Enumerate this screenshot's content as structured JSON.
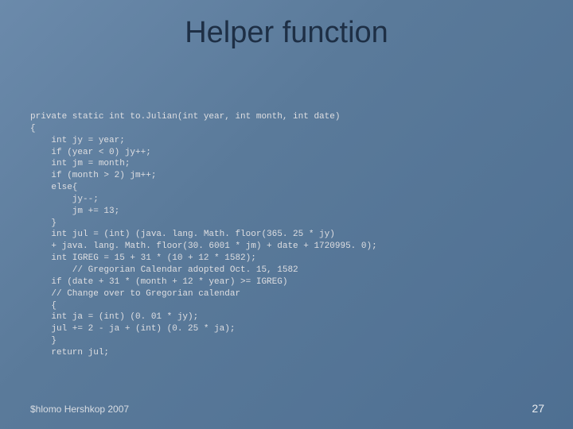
{
  "title": "Helper function",
  "code": "private static int to.Julian(int year, int month, int date)\n{\n    int jy = year;\n    if (year < 0) jy++;\n    int jm = month;\n    if (month > 2) jm++;\n    else{\n        jy--;\n        jm += 13;\n    }\n    int jul = (int) (java. lang. Math. floor(365. 25 * jy)\n    + java. lang. Math. floor(30. 6001 * jm) + date + 1720995. 0);\n    int IGREG = 15 + 31 * (10 + 12 * 1582);\n        // Gregorian Calendar adopted Oct. 15, 1582\n    if (date + 31 * (month + 12 * year) >= IGREG)\n    // Change over to Gregorian calendar\n    {\n    int ja = (int) (0. 01 * jy);\n    jul += 2 - ja + (int) (0. 25 * ja);\n    }\n    return jul;",
  "footer_left": "$hlomo Hershkop 2007",
  "footer_right": "27"
}
